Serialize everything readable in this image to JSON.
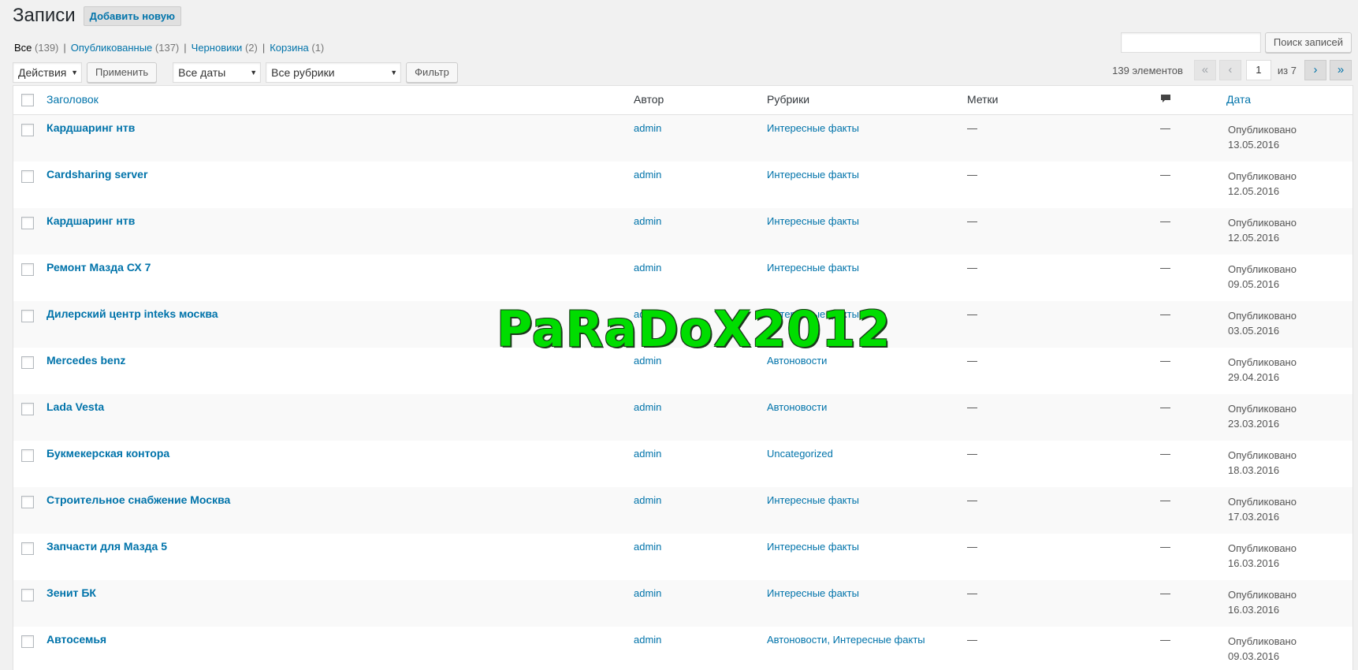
{
  "header": {
    "title": "Записи",
    "add_new_label": "Добавить новую"
  },
  "status_links": [
    {
      "label": "Все",
      "count": "(139)"
    },
    {
      "label": "Опубликованные",
      "count": "(137)"
    },
    {
      "label": "Черновики",
      "count": "(2)"
    },
    {
      "label": "Корзина",
      "count": "(1)"
    }
  ],
  "search": {
    "value": "",
    "button_label": "Поиск записей"
  },
  "toolbar": {
    "bulk_action": "Действия",
    "apply_label": "Применить",
    "date_filter": "Все даты",
    "category_filter": "Все рубрики",
    "filter_label": "Фильтр"
  },
  "pagination": {
    "items_text": "139 элементов",
    "first": "«",
    "prev": "‹",
    "current_page": "1",
    "total_text": "из 7",
    "next": "›",
    "last": "»"
  },
  "columns": {
    "title": "Заголовок",
    "author": "Автор",
    "categories": "Рубрики",
    "tags": "Метки",
    "date": "Дата"
  },
  "posts": [
    {
      "title": "Кардшаринг нтв",
      "author": "admin",
      "categories": "Интересные факты",
      "tags": "—",
      "comments": "—",
      "status": "Опубликовано",
      "date": "13.05.2016"
    },
    {
      "title": "Cardsharing server",
      "author": "admin",
      "categories": "Интересные факты",
      "tags": "—",
      "comments": "—",
      "status": "Опубликовано",
      "date": "12.05.2016"
    },
    {
      "title": "Кардшаринг нтв",
      "author": "admin",
      "categories": "Интересные факты",
      "tags": "—",
      "comments": "—",
      "status": "Опубликовано",
      "date": "12.05.2016"
    },
    {
      "title": "Ремонт Мазда СХ 7",
      "author": "admin",
      "categories": "Интересные факты",
      "tags": "—",
      "comments": "—",
      "status": "Опубликовано",
      "date": "09.05.2016"
    },
    {
      "title": "Дилерский центр inteks москва",
      "author": "admin",
      "categories": "Интересные факты",
      "tags": "—",
      "comments": "—",
      "status": "Опубликовано",
      "date": "03.05.2016"
    },
    {
      "title": "Mercedes benz",
      "author": "admin",
      "categories": "Автоновости",
      "tags": "—",
      "comments": "—",
      "status": "Опубликовано",
      "date": "29.04.2016"
    },
    {
      "title": "Lada Vesta",
      "author": "admin",
      "categories": "Автоновости",
      "tags": "—",
      "comments": "—",
      "status": "Опубликовано",
      "date": "23.03.2016"
    },
    {
      "title": "Букмекерская контора",
      "author": "admin",
      "categories": "Uncategorized",
      "tags": "—",
      "comments": "—",
      "status": "Опубликовано",
      "date": "18.03.2016"
    },
    {
      "title": "Строительное снабжение Москва",
      "author": "admin",
      "categories": "Интересные факты",
      "tags": "—",
      "comments": "—",
      "status": "Опубликовано",
      "date": "17.03.2016"
    },
    {
      "title": "Запчасти для Мазда 5",
      "author": "admin",
      "categories": "Интересные факты",
      "tags": "—",
      "comments": "—",
      "status": "Опубликовано",
      "date": "16.03.2016"
    },
    {
      "title": "Зенит БК",
      "author": "admin",
      "categories": "Интересные факты",
      "tags": "—",
      "comments": "—",
      "status": "Опубликовано",
      "date": "16.03.2016"
    },
    {
      "title": "Автосемья",
      "author": "admin",
      "categories": "Автоновости, Интересные факты",
      "tags": "—",
      "comments": "—",
      "status": "Опубликовано",
      "date": "09.03.2016"
    }
  ],
  "watermark": "PaRaDoX2012",
  "colors": {
    "link": "#0073aa",
    "background": "#f1f1f1",
    "watermark": "#00dd00"
  }
}
